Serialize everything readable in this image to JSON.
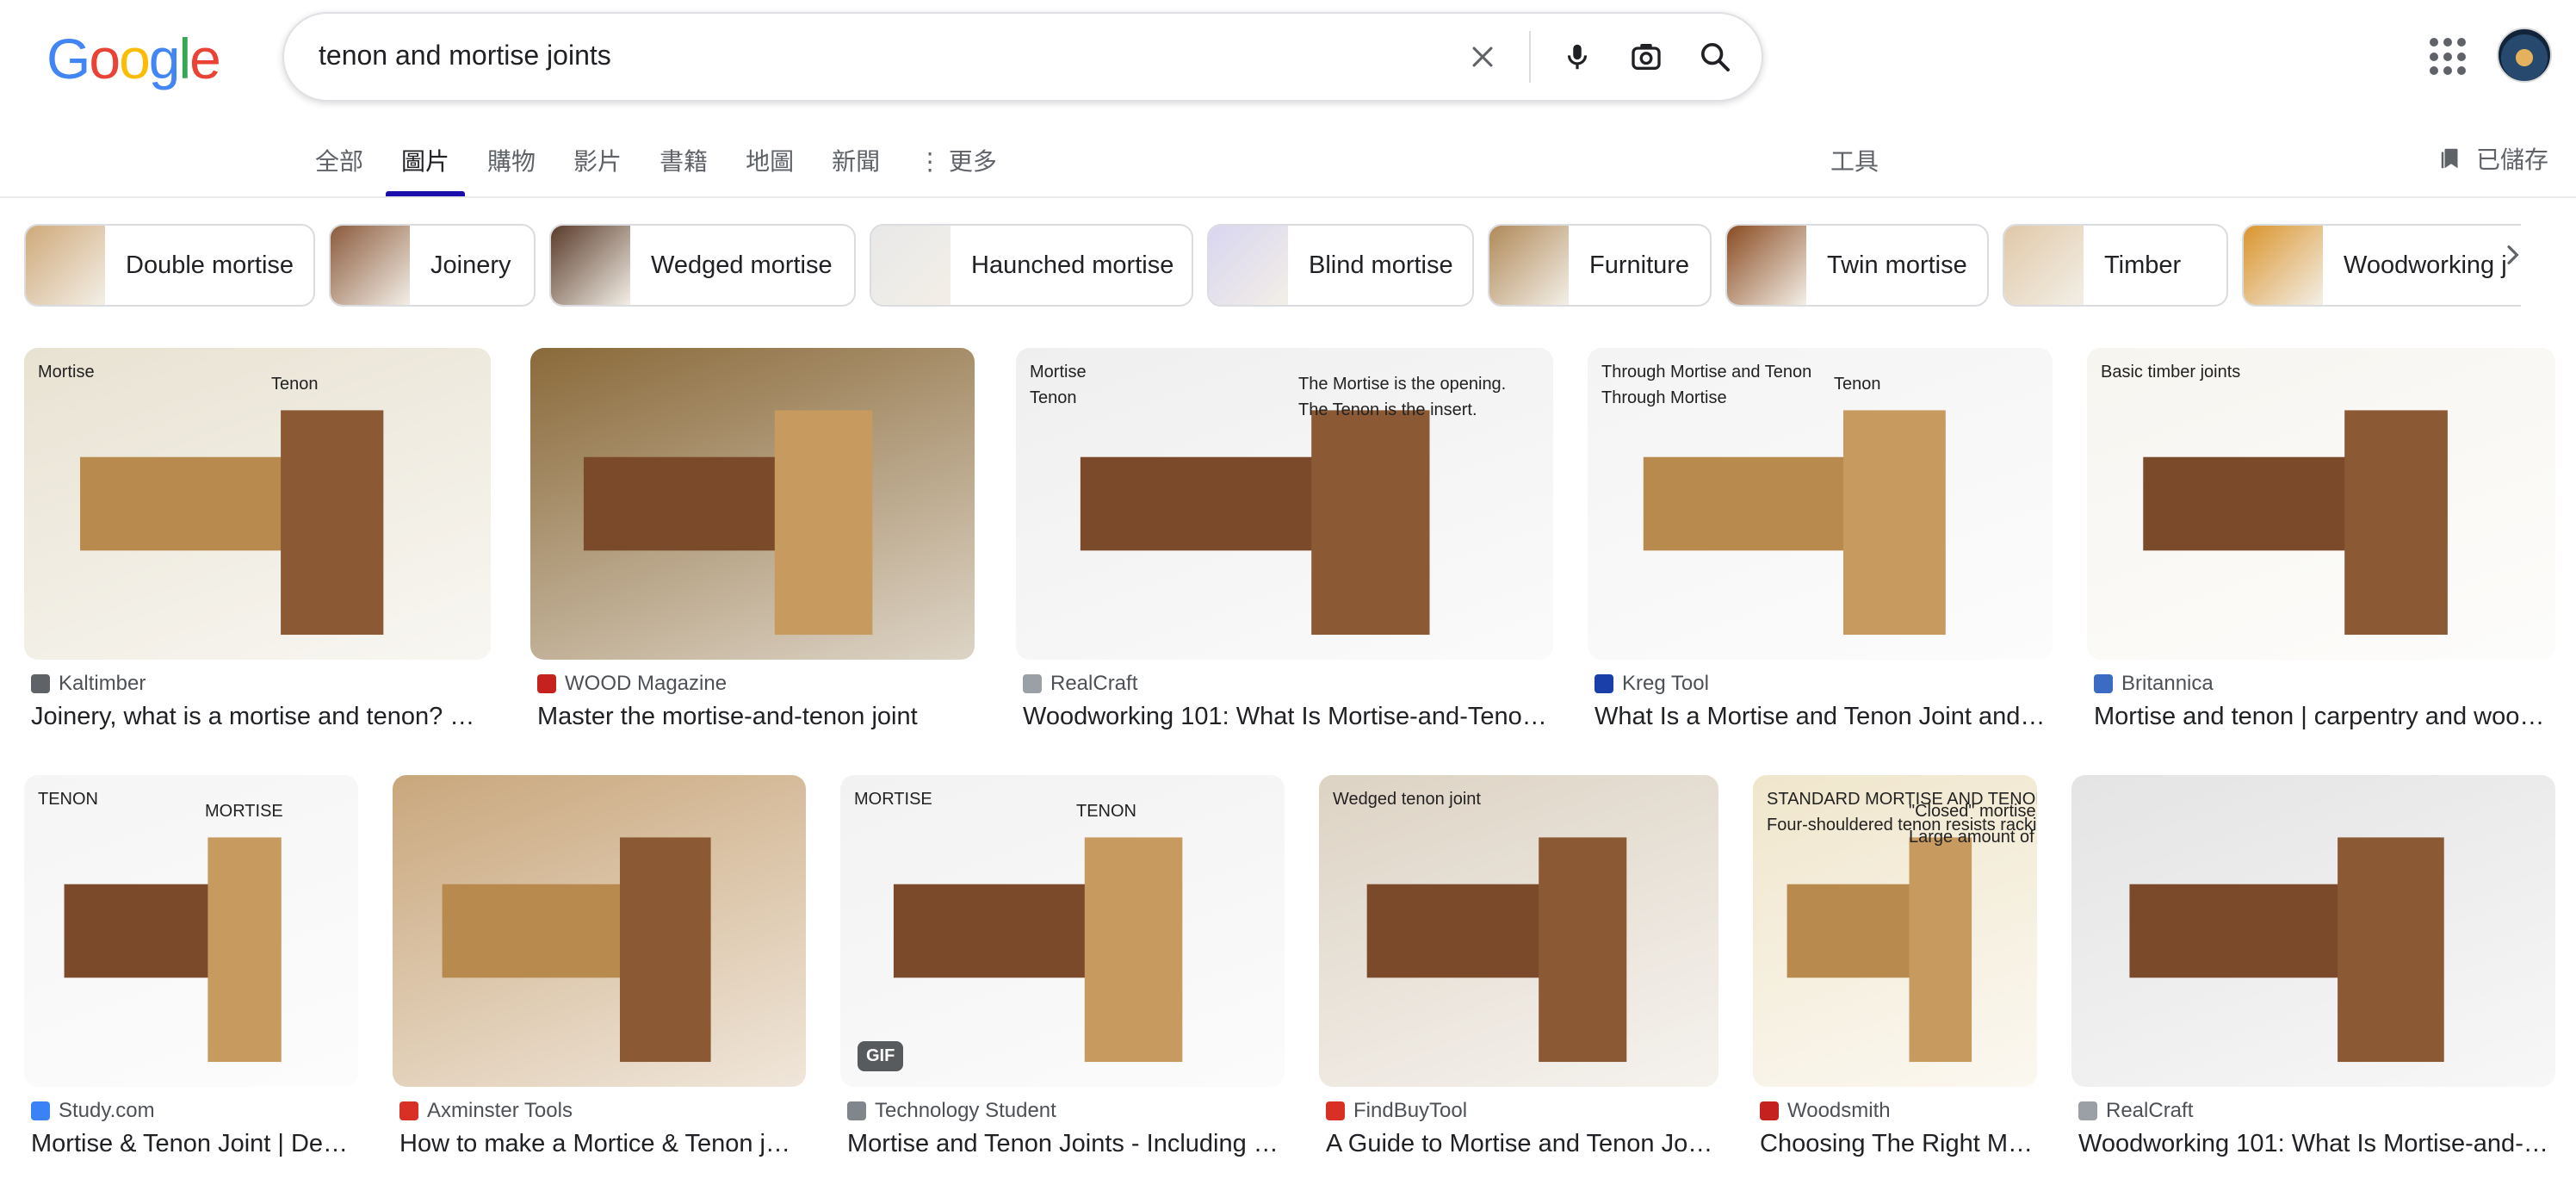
{
  "logo": {
    "letters": [
      "G",
      "o",
      "o",
      "g",
      "l",
      "e"
    ],
    "colors": [
      "#4285f4",
      "#ea4335",
      "#fbbc05",
      "#4285f4",
      "#34a853",
      "#ea4335"
    ]
  },
  "search": {
    "query": "tenon and mortise joints"
  },
  "tabs": [
    {
      "label": "全部"
    },
    {
      "label": "圖片"
    },
    {
      "label": "購物"
    },
    {
      "label": "影片"
    },
    {
      "label": "書籍"
    },
    {
      "label": "地圖"
    },
    {
      "label": "新聞"
    },
    {
      "label": "更多"
    }
  ],
  "tools_label": "工具",
  "saved_label": "已儲存",
  "chips": [
    {
      "label": "Double mortise",
      "thumb": "#cfa97a"
    },
    {
      "label": "Joinery",
      "thumb": "#8b5a3c"
    },
    {
      "label": "Wedged mortise",
      "thumb": "#5a3b2a"
    },
    {
      "label": "Haunched mortise",
      "thumb": "#e8e8e8"
    },
    {
      "label": "Blind mortise",
      "thumb": "#d8d5f0"
    },
    {
      "label": "Furniture",
      "thumb": "#b08a5a"
    },
    {
      "label": "Twin mortise",
      "thumb": "#8a4b22"
    },
    {
      "label": "Timber",
      "thumb": "#e0c8a8"
    },
    {
      "label": "Woodworking j",
      "thumb": "#d9952e"
    }
  ],
  "results": [
    {
      "source": "Kaltimber",
      "title": "Joinery, what is a mortise and tenon? …",
      "favicon": "#5f6368",
      "bg": "#e8e2d2",
      "labels": [
        "Mortise",
        "Tenon"
      ]
    },
    {
      "source": "WOOD Magazine",
      "title": "Master the mortise-and-tenon joint",
      "favicon": "#c5221f",
      "bg": "#8a6a3a",
      "labels": []
    },
    {
      "source": "RealCraft",
      "title": "Woodworking 101: What Is Mortise-and-Teno…",
      "favicon": "#9aa0a6",
      "bg": "#efefef",
      "labels": [
        "Mortise",
        "The Mortise is the opening.",
        "Tenon",
        "The Tenon is the insert."
      ]
    },
    {
      "source": "Kreg Tool",
      "title": "What Is a Mortise and Tenon Joint and…",
      "favicon": "#1a3fa8",
      "bg": "#f4f4f4",
      "labels": [
        "Through Mortise and Tenon",
        "Tenon",
        "Through Mortise"
      ]
    },
    {
      "source": "Britannica",
      "title": "Mortise and tenon | carpentry and woo…",
      "favicon": "#3c6bc4",
      "bg": "#f7f5f0",
      "labels": [
        "Basic timber joints"
      ]
    },
    {
      "source": "Study.com",
      "title": "Mortise & Tenon Joint | De…",
      "favicon": "#3b82f6",
      "bg": "#f5f5f5",
      "labels": [
        "TENON",
        "MORTISE"
      ]
    },
    {
      "source": "Axminster Tools",
      "title": "How to make a Mortice & Tenon j…",
      "favicon": "#d93025",
      "bg": "#c9a77c",
      "labels": []
    },
    {
      "source": "Technology Student",
      "title": "Mortise and Tenon Joints - Including …",
      "favicon": "#80868b",
      "bg": "#f2f2f2",
      "labels": [
        "MORTISE",
        "TENON"
      ],
      "badge": "GIF"
    },
    {
      "source": "FindBuyTool",
      "title": "A Guide to Mortise and Tenon Jo…",
      "favicon": "#d93025",
      "bg": "#ddd3c4",
      "labels": [
        "Wedged tenon joint"
      ]
    },
    {
      "source": "Woodsmith",
      "title": "Choosing The Right M…",
      "favicon": "#c5221f",
      "bg": "#f0e6cc",
      "labels": [
        "STANDARD MORTISE AND TENON",
        "\"Closed\" mortise captures tenon on all four sides",
        "Four-shouldered tenon resists racking",
        "Large amount of gluing surface on cheeks of tenon and mortise"
      ]
    },
    {
      "source": "RealCraft",
      "title": "Woodworking 101: What Is Mortise-and-…",
      "favicon": "#9aa0a6",
      "bg": "#e4e4e4",
      "labels": []
    }
  ]
}
